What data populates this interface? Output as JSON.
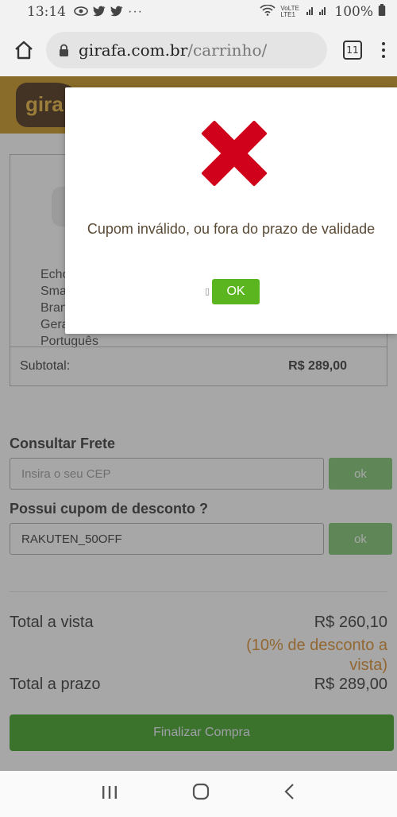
{
  "status_bar": {
    "time": "13:14",
    "icons_left": [
      "eye-icon",
      "twitter-icon",
      "twitter-icon",
      "more-icon"
    ],
    "network": "VoLTE LTE1",
    "battery": "100%"
  },
  "browser": {
    "domain": "girafa.com.br",
    "path": "/carrinho/",
    "tab_count": "11"
  },
  "site": {
    "logo_text": "gira"
  },
  "cart": {
    "product_lines": [
      "Echo",
      "Sma",
      "Bran",
      "Gera",
      "Português"
    ],
    "subtotal_label": "Subtotal:",
    "subtotal_value": "R$ 289,00"
  },
  "shipping": {
    "title": "Consultar Frete",
    "cep_placeholder": "Insira o seu CEP",
    "ok_label": "ok"
  },
  "coupon": {
    "title": "Possui cupom de desconto ?",
    "value": "RAKUTEN_50OFF",
    "ok_label": "ok"
  },
  "totals": {
    "vista_label": "Total a vista",
    "vista_value": "R$ 260,10",
    "discount_note": "(10% de desconto a vista)",
    "prazo_label": "Total a prazo",
    "prazo_value": "R$ 289,00"
  },
  "checkout_label": "Finalizar Compra",
  "modal": {
    "icon": "error-x-icon",
    "message": "Cupom inválido, ou fora do prazo de validade",
    "ok_label": "OK",
    "colors": {
      "x": "#d0021b",
      "ok": "#5bb51f"
    }
  },
  "nav": {
    "recents": "|||",
    "home": "○",
    "back": "<"
  },
  "colors": {
    "header": "#c8941a",
    "accent_green": "#3da11f",
    "discount_orange": "#d98a2b"
  }
}
